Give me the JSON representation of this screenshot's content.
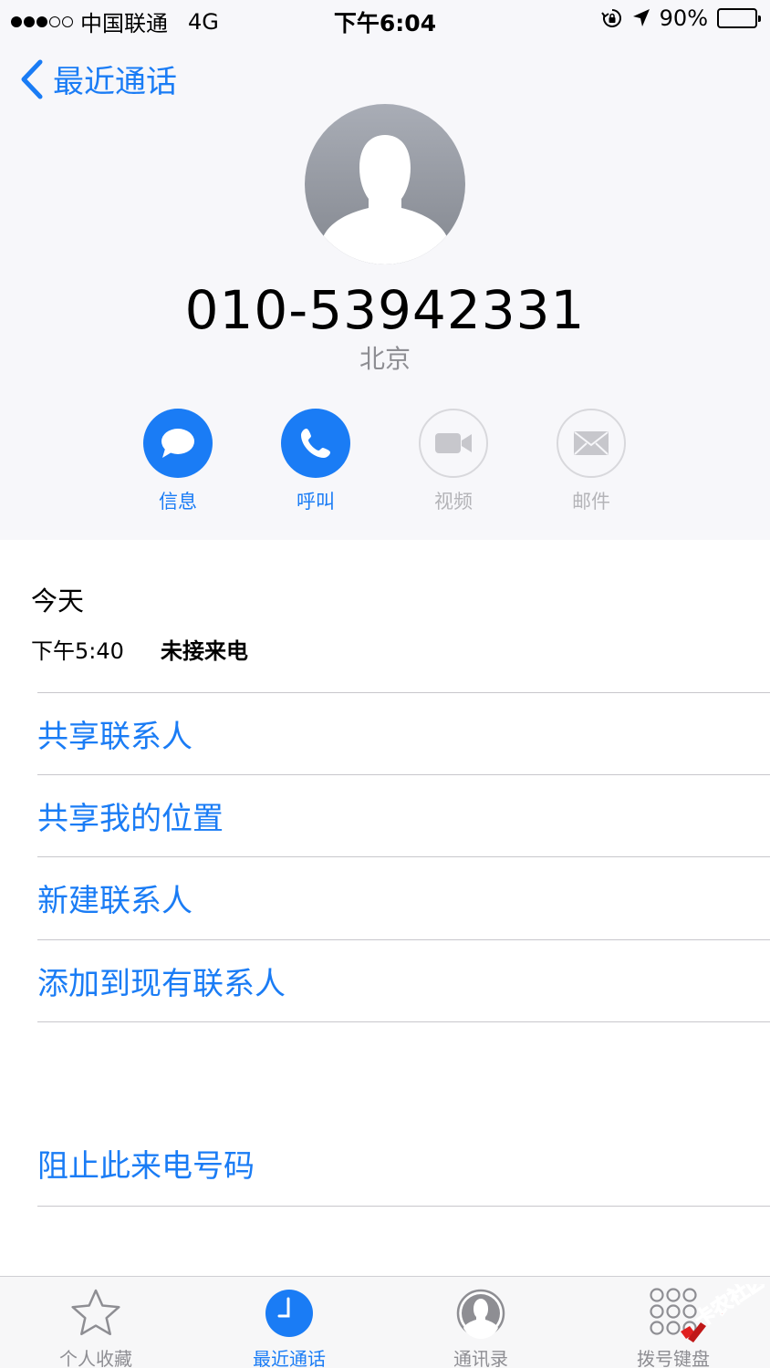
{
  "status_bar": {
    "carrier": "中国联通",
    "network": "4G",
    "time": "下午6:04",
    "battery": "90%",
    "battery_level": 0.9
  },
  "nav": {
    "back_label": "最近通话"
  },
  "contact": {
    "number": "010-53942331",
    "location": "北京"
  },
  "actions": [
    {
      "label": "信息",
      "icon": "message-icon",
      "enabled": true
    },
    {
      "label": "呼叫",
      "icon": "phone-icon",
      "enabled": true
    },
    {
      "label": "视频",
      "icon": "video-icon",
      "enabled": false
    },
    {
      "label": "邮件",
      "icon": "mail-icon",
      "enabled": false
    }
  ],
  "recents": {
    "day": "今天",
    "entries": [
      {
        "time": "下午5:40",
        "status": "未接来电"
      }
    ]
  },
  "menu": [
    "共享联系人",
    "共享我的位置",
    "新建联系人",
    "添加到现有联系人"
  ],
  "block_label": "阻止此来电号码",
  "tabs": [
    {
      "label": "个人收藏",
      "icon": "star-icon",
      "active": false
    },
    {
      "label": "最近通话",
      "icon": "clock-icon",
      "active": true
    },
    {
      "label": "通讯录",
      "icon": "contacts-icon",
      "active": false
    },
    {
      "label": "拨号键盘",
      "icon": "keypad-icon",
      "active": false
    }
  ],
  "watermark": "卡农社区",
  "colors": {
    "accent": "#1a7cf5",
    "disabled": "#b4b4b8",
    "background": "#f7f7fa"
  }
}
